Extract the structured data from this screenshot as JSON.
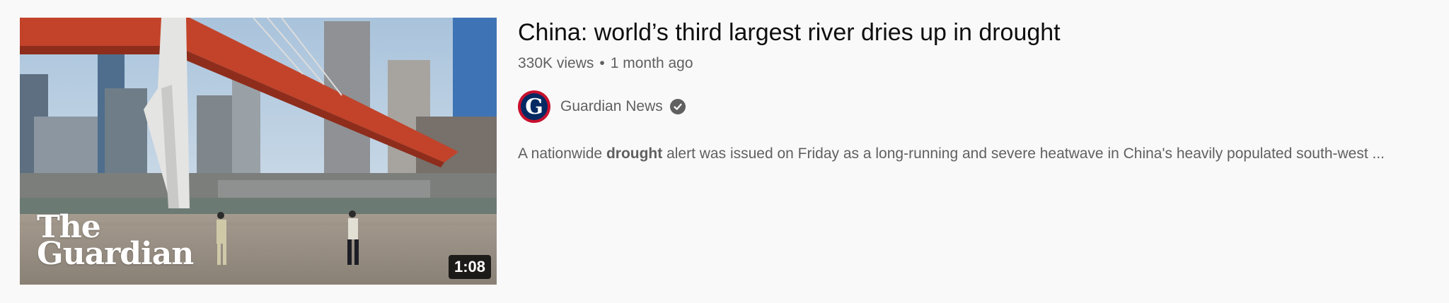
{
  "video": {
    "title": "China: world’s third largest river dries up in drought",
    "views": "330K views",
    "separator": "•",
    "age": "1 month ago",
    "duration": "1:08",
    "thumbnail_wordmark": [
      "The",
      "Guardian"
    ]
  },
  "channel": {
    "name": "Guardian News",
    "avatar_letter": "G",
    "verified_icon": "verified-check-icon"
  },
  "description": {
    "before": "A nationwide ",
    "highlight": "drought",
    "after": " alert was issued on Friday as a long-running and severe heatwave in China's heavily populated south-west ..."
  },
  "colors": {
    "brand_red": "#c8102e",
    "brand_navy": "#052962",
    "text_primary": "#0f0f0f",
    "text_secondary": "#606060"
  }
}
